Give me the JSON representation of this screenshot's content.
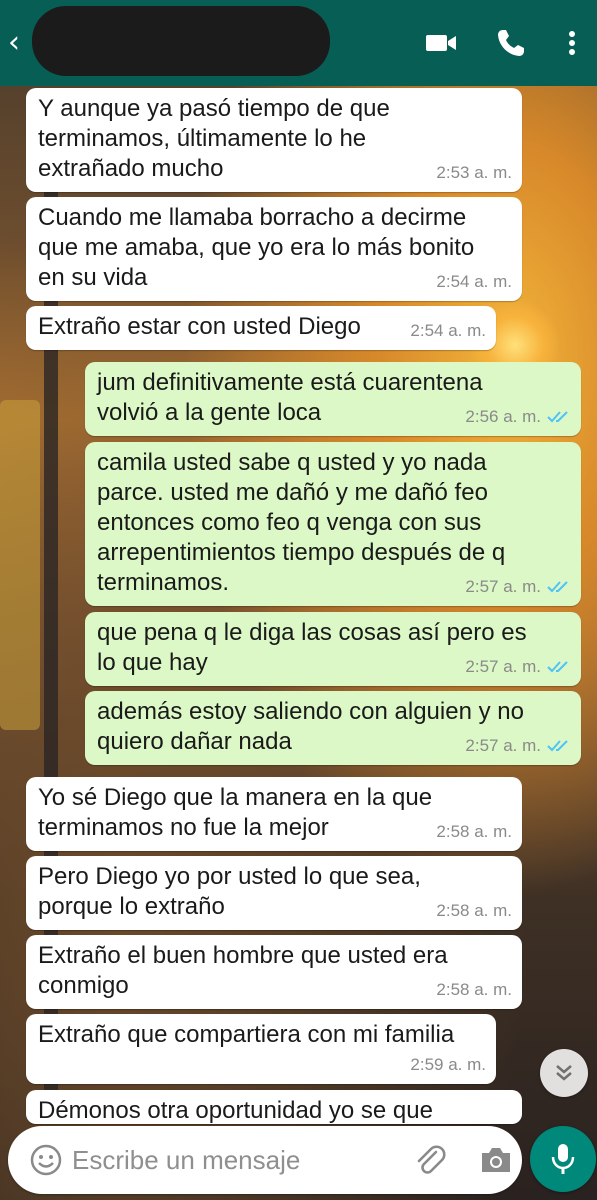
{
  "header": {
    "contact_name": "",
    "icons": [
      "back-icon",
      "video-call-icon",
      "voice-call-icon",
      "more-options-icon"
    ]
  },
  "messages": [
    {
      "direction": "in",
      "text": "Y aunque ya pasó tiempo de que\nterminamos, últimamente lo he\nextrañado mucho",
      "time": "2:53 a. m."
    },
    {
      "direction": "in",
      "text": "Cuando me llamaba borracho a decirme\nque me amaba, que yo era lo más bonito\nen su vida",
      "time": "2:54 a. m."
    },
    {
      "direction": "in",
      "text": "Extraño estar con usted Diego",
      "time": "2:54 a. m."
    },
    {
      "direction": "out",
      "text": "jum definitivamente está cuarentena\nvolvió a la gente loca",
      "time": "2:56 a. m.",
      "status": "read"
    },
    {
      "direction": "out",
      "text": "camila usted sabe q usted y yo nada\nparce. usted me dañó y me dañó feo\nentonces como feo q venga con sus\narrepentimientos tiempo después de q\nterminamos.",
      "time": "2:57 a. m.",
      "status": "read"
    },
    {
      "direction": "out",
      "text": "que pena q le diga las cosas así pero es\nlo que hay",
      "time": "2:57 a. m.",
      "status": "read"
    },
    {
      "direction": "out",
      "text": "además estoy saliendo con alguien y no\nquiero dañar nada",
      "time": "2:57 a. m.",
      "status": "read"
    },
    {
      "direction": "in",
      "text": "Yo sé Diego que la manera en la que\nterminamos no fue la mejor",
      "time": "2:58 a. m."
    },
    {
      "direction": "in",
      "text": "Pero Diego yo por usted lo que sea,\nporque lo extraño",
      "time": "2:58 a. m."
    },
    {
      "direction": "in",
      "text": "Extraño el buen hombre que usted era\nconmigo",
      "time": "2:58 a. m."
    },
    {
      "direction": "in",
      "text": "Extraño que compartiera con mi familia",
      "time": "2:59 a. m."
    },
    {
      "direction": "in",
      "text": "Démonos otra oportunidad yo se que",
      "time": ""
    }
  ],
  "composer": {
    "placeholder": "Escribe un mensaje",
    "value": ""
  },
  "colors": {
    "header": "#075e54",
    "incoming_bubble": "#ffffff",
    "outgoing_bubble": "#dcf8c6",
    "read_ticks": "#4fc3f7",
    "mic_button": "#00897b"
  }
}
